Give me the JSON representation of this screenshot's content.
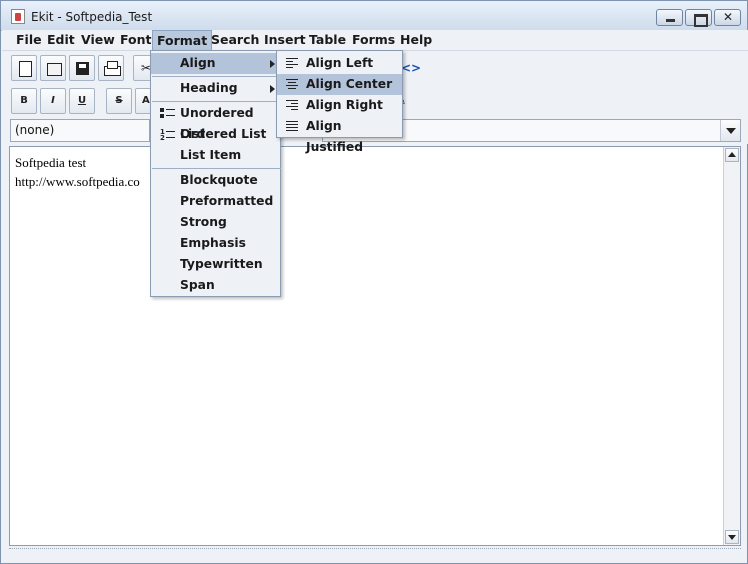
{
  "window": {
    "title": "Ekit - Softpedia_Test"
  },
  "menubar": [
    "File",
    "Edit",
    "View",
    "Font",
    "Format",
    "Search",
    "Insert",
    "Table",
    "Forms",
    "Help"
  ],
  "toolbar2": {
    "bold": "B",
    "italic": "I",
    "underline": "U",
    "strike": "S",
    "super": "A²"
  },
  "style_combo": {
    "value": "(none)"
  },
  "editor": {
    "lines": [
      "Softpedia test",
      "http://www.softpedia.co"
    ]
  },
  "format_menu": {
    "align": "Align",
    "heading": "Heading",
    "unordered_list": "Unordered List",
    "ordered_list": "Ordered List",
    "list_item": "List Item",
    "blockquote": "Blockquote",
    "preformatted": "Preformatted",
    "strong": "Strong",
    "emphasis": "Emphasis",
    "typewritten": "Typewritten",
    "span": "Span"
  },
  "align_menu": {
    "left": "Align Left",
    "center": "Align Center",
    "right": "Align Right",
    "justified": "Align Justified"
  },
  "colors": {
    "menu_highlight": "#b3c3d9",
    "active_menu": "#b8c8dd"
  }
}
